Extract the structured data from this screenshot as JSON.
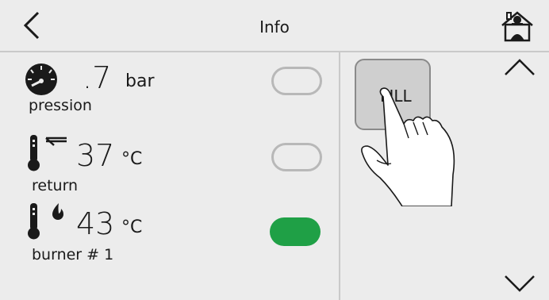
{
  "header": {
    "title": "Info",
    "back_icon": "chevron-left-icon",
    "home_icon": "home-user-icon"
  },
  "rows": [
    {
      "value": ".7",
      "unit": "bar",
      "label": "pression",
      "icon": "pressure-gauge-icon",
      "toggle_on": false
    },
    {
      "value": "37",
      "unit": "°C",
      "label": "return",
      "icon": "thermometer-return-icon",
      "toggle_on": false
    },
    {
      "value": "43",
      "unit": "°C",
      "label": "burner # 1",
      "icon": "thermometer-flame-icon",
      "toggle_on": true
    }
  ],
  "right_panel": {
    "fill_label": "FILL",
    "scroll_up_icon": "chevron-up-icon",
    "scroll_down_icon": "chevron-down-icon"
  },
  "colors": {
    "toggle_on": "#1fa046",
    "toggle_off_border": "#b8b8b8",
    "background": "#ececec"
  }
}
